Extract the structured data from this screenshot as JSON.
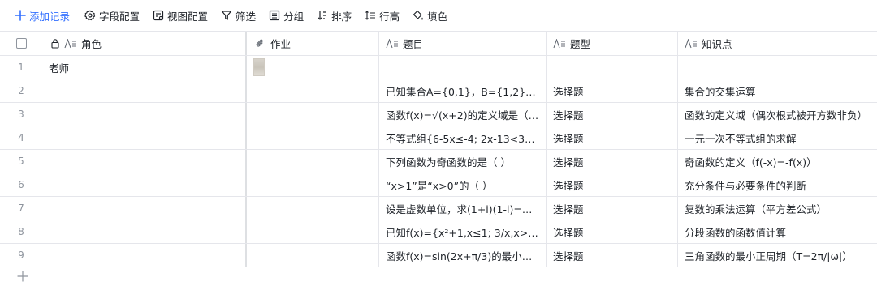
{
  "toolbar": {
    "add_record": "添加记录",
    "field_config": "字段配置",
    "view_config": "视图配置",
    "filter": "筛选",
    "group": "分组",
    "sort": "排序",
    "row_height": "行高",
    "fill_color": "填色"
  },
  "columns": {
    "role": "角色",
    "homework": "作业",
    "question": "题目",
    "question_type": "题型",
    "knowledge": "知识点"
  },
  "rows": [
    {
      "index": "1",
      "role": "老师",
      "has_attachment": true,
      "question": "",
      "type": "",
      "knowledge": ""
    },
    {
      "index": "2",
      "role": "",
      "has_attachment": false,
      "question": "已知集合A={0,1}，B={1,2}，...",
      "type": "选择题",
      "knowledge": "集合的交集运算"
    },
    {
      "index": "3",
      "role": "",
      "has_attachment": false,
      "question": "函数f(x)=√(x+2)的定义域是（ ）",
      "type": "选择题",
      "knowledge": "函数的定义域（偶次根式被开方数非负）"
    },
    {
      "index": "4",
      "role": "",
      "has_attachment": false,
      "question": "不等式组{6-5x≤-4; 2x-13<3}的...",
      "type": "选择题",
      "knowledge": "一元一次不等式组的求解"
    },
    {
      "index": "5",
      "role": "",
      "has_attachment": false,
      "question": "下列函数为奇函数的是（ ）",
      "type": "选择题",
      "knowledge": "奇函数的定义（f(-x)=-f(x)）"
    },
    {
      "index": "6",
      "role": "",
      "has_attachment": false,
      "question": "“x>1”是“x>0”的（ ）",
      "type": "选择题",
      "knowledge": "充分条件与必要条件的判断"
    },
    {
      "index": "7",
      "role": "",
      "has_attachment": false,
      "question": "设是虚数单位，求(1+i)(1-i)=（...",
      "type": "选择题",
      "knowledge": "复数的乘法运算（平方差公式）"
    },
    {
      "index": "8",
      "role": "",
      "has_attachment": false,
      "question": "已知f(x)={x²+1,x≤1; 3/x,x>1}...",
      "type": "选择题",
      "knowledge": "分段函数的函数值计算"
    },
    {
      "index": "9",
      "role": "",
      "has_attachment": false,
      "question": "函数f(x)=sin(2x+π/3)的最小正...",
      "type": "选择题",
      "knowledge": "三角函数的最小正周期（T=2π/|ω|）"
    }
  ],
  "colors": {
    "accent": "#3370ff",
    "border": "#e5e6eb",
    "muted": "#8f959e"
  }
}
